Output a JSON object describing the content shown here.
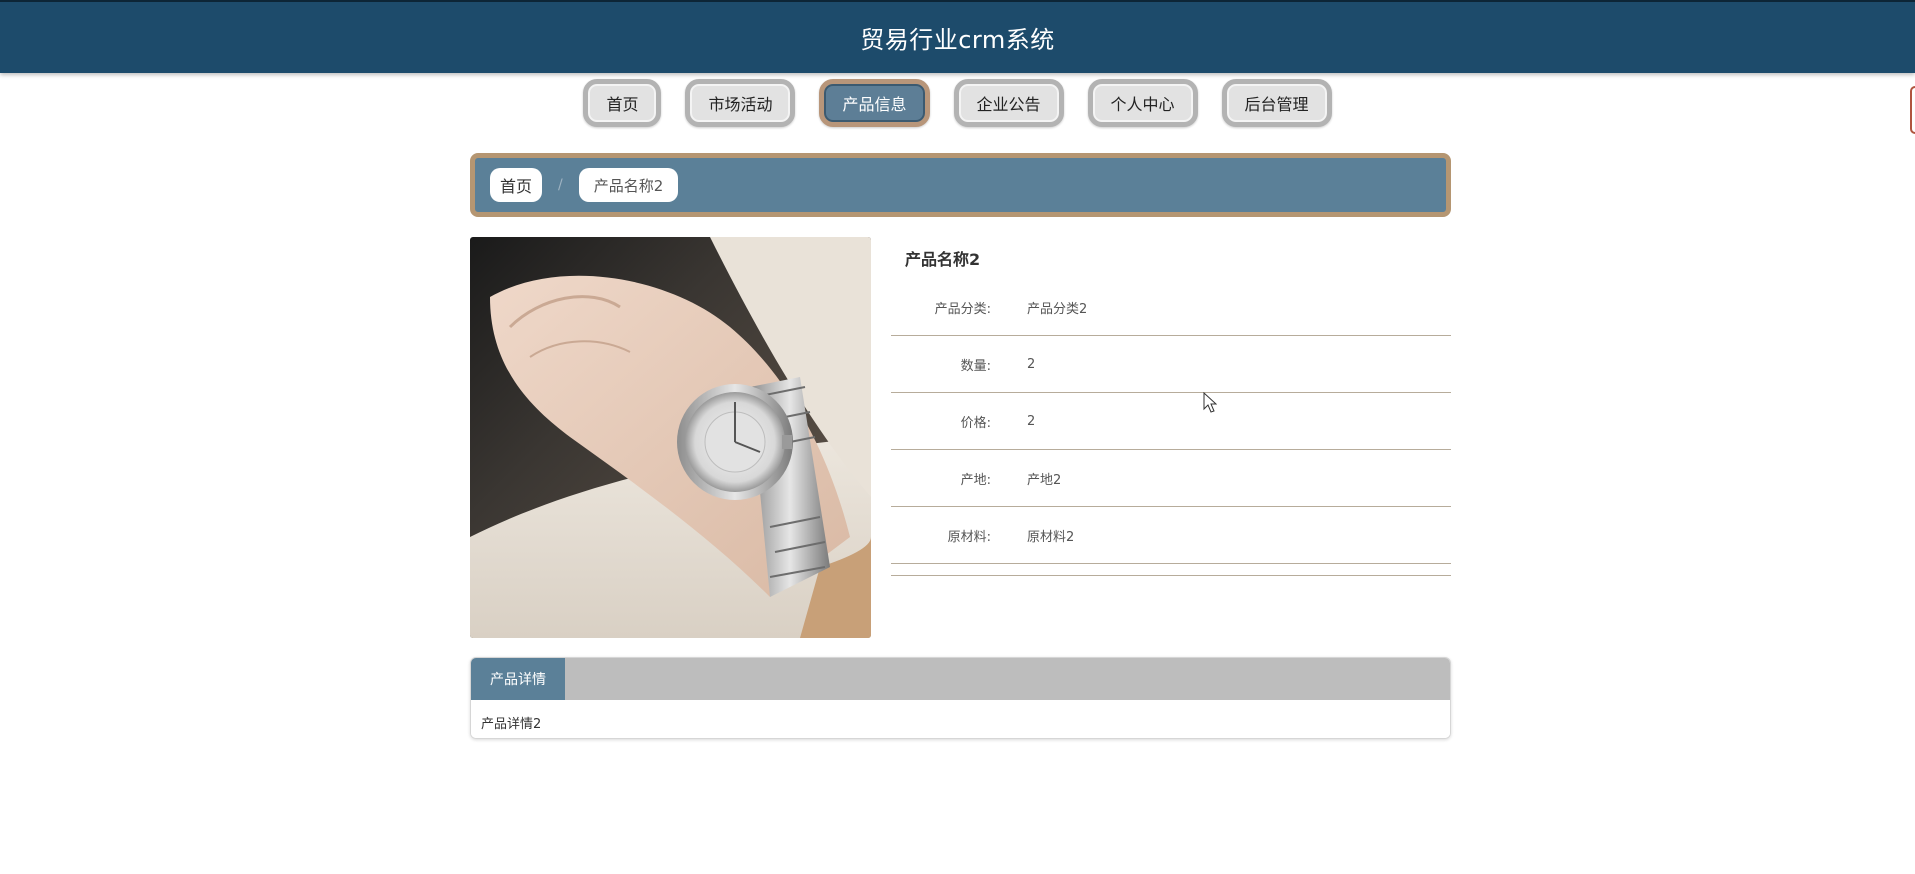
{
  "header": {
    "title": "贸易行业crm系统"
  },
  "nav": {
    "items": [
      {
        "label": "首页",
        "active": false
      },
      {
        "label": "市场活动",
        "active": false
      },
      {
        "label": "产品信息",
        "active": true
      },
      {
        "label": "企业公告",
        "active": false
      },
      {
        "label": "个人中心",
        "active": false
      },
      {
        "label": "后台管理",
        "active": false
      }
    ]
  },
  "breadcrumb": {
    "home": "首页",
    "separator": "/",
    "current": "产品名称2"
  },
  "product": {
    "image_icon": "wristwatch-photo",
    "name": "产品名称2",
    "fields": [
      {
        "label": "产品分类:",
        "value": "产品分类2"
      },
      {
        "label": "数量:",
        "value": "2"
      },
      {
        "label": "价格:",
        "value": "2"
      },
      {
        "label": "产地:",
        "value": "产地2"
      },
      {
        "label": "原材料:",
        "value": "原材料2"
      }
    ]
  },
  "detail": {
    "tab_label": "产品详情",
    "content": "产品详情2"
  },
  "colors": {
    "header_bg": "#1d4b6b",
    "accent": "#5b8098",
    "accent_border": "#b59672"
  }
}
